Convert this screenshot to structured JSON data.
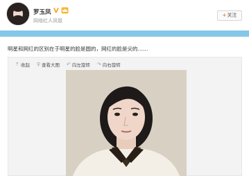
{
  "header": {
    "username": "罗玉凤",
    "subtitle": "网络红人凤姐",
    "follow_label": "关注",
    "icons": [
      "avatar",
      "verified-v-icon",
      "crown-badge-icon",
      "plus-icon"
    ]
  },
  "post": {
    "text": "明星和网红的区别在于明星的脸是圆的，网红的脸是尖的……"
  },
  "media_toolbar": {
    "items": [
      {
        "icon": "collapse-up-icon",
        "label": "收起"
      },
      {
        "icon": "magnify-icon",
        "label": "查看大图"
      },
      {
        "icon": "rotate-left-icon",
        "label": "向左旋转"
      },
      {
        "icon": "rotate-right-icon",
        "label": "向右旋转"
      }
    ]
  },
  "colors": {
    "accent_blue": "#85c7e8",
    "verify_orange": "#f7a21b",
    "plus_orange": "#f77c3d",
    "link_icon_blue": "#7a99c4"
  }
}
